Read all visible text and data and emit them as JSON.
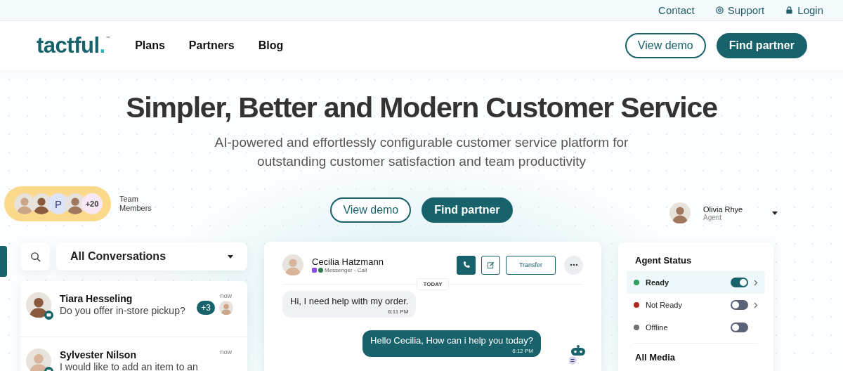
{
  "top_bar": {
    "links": [
      {
        "label": "Contact",
        "kind": "plain"
      },
      {
        "label": "Support",
        "kind": "support"
      },
      {
        "label": "Login",
        "kind": "lock"
      }
    ]
  },
  "nav": {
    "logo": "tactful.",
    "trademark": "™",
    "links": [
      "Plans",
      "Partners",
      "Blog"
    ],
    "buttons": [
      {
        "label": "View demo",
        "kind": "outline"
      },
      {
        "label": "Find partner",
        "kind": "filled"
      }
    ]
  },
  "hero": {
    "title": "Simpler, Better and Modern Customer Service",
    "subtitle": "AI-powered and effortlessly configurable customer service platform for outstanding customer satisfaction and team productivity",
    "buttons": [
      {
        "label": "View demo",
        "kind": "outline"
      },
      {
        "label": "Find partner",
        "kind": "filled"
      }
    ]
  },
  "team": {
    "members": [
      {
        "kind": "photo"
      },
      {
        "kind": "photo"
      },
      {
        "kind": "initial",
        "text": "P"
      },
      {
        "kind": "photo"
      },
      {
        "kind": "count",
        "text": "+20"
      }
    ],
    "label": "Team Members"
  },
  "agent": {
    "name": "Olivia Rhye",
    "role": "Agent"
  },
  "conversations": {
    "filter": "All Conversations",
    "items": [
      {
        "name": "Tiara Hesseling",
        "preview": "Do you offer in-store pickup?",
        "time": "now",
        "badge": "+3"
      },
      {
        "name": "Sylvester Nilson",
        "preview": "I would like to add an item to an",
        "time": "now"
      }
    ]
  },
  "chat": {
    "contact": "Cecilia Hatzmann",
    "channel": "Messenger - Call",
    "transfer": "Transfer",
    "date": "TODAY",
    "messages": [
      {
        "kind": "incoming",
        "text": "Hi, I need help with my order.",
        "time": "6:11 PM"
      },
      {
        "kind": "outgoing",
        "text": "Hello Cecilia, How can i help you today?",
        "time": "6:12 PM"
      }
    ]
  },
  "agent_status": {
    "title": "Agent Status",
    "items": [
      {
        "label": "Ready",
        "color": "#2e9e5e",
        "on": true,
        "selected": true,
        "expandable": true
      },
      {
        "label": "Not Ready",
        "color": "#b3261e",
        "on": false,
        "selected": false,
        "expandable": true
      },
      {
        "label": "Offline",
        "color": "#707070",
        "on": false,
        "selected": false,
        "expandable": false
      }
    ],
    "section": "All Media"
  }
}
